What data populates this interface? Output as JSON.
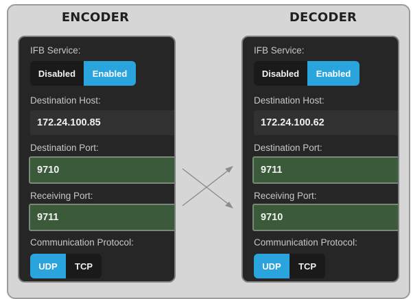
{
  "encoder": {
    "title": "ENCODER",
    "ifb_label": "IFB Service:",
    "ifb_options": [
      "Disabled",
      "Enabled"
    ],
    "ifb_selected": "Enabled",
    "dest_host_label": "Destination Host:",
    "dest_host_value": "172.24.100.85",
    "dest_port_label": "Destination Port:",
    "dest_port_value": "9710",
    "recv_port_label": "Receiving Port:",
    "recv_port_value": "9711",
    "protocol_label": "Communication Protocol:",
    "protocol_options": [
      "UDP",
      "TCP"
    ],
    "protocol_selected": "UDP"
  },
  "decoder": {
    "title": "DECODER",
    "ifb_label": "IFB Service:",
    "ifb_options": [
      "Disabled",
      "Enabled"
    ],
    "ifb_selected": "Enabled",
    "dest_host_label": "Destination Host:",
    "dest_host_value": "172.24.100.62",
    "dest_port_label": "Destination Port:",
    "dest_port_value": "9711",
    "recv_port_label": "Receiving Port:",
    "recv_port_value": "9710",
    "protocol_label": "Communication Protocol:",
    "protocol_options": [
      "UDP",
      "TCP"
    ],
    "protocol_selected": "UDP"
  },
  "colors": {
    "accent": "#2aa4dc",
    "panel": "#262626",
    "field_green": "#3a5a3a",
    "frame": "#d6d6d6"
  }
}
